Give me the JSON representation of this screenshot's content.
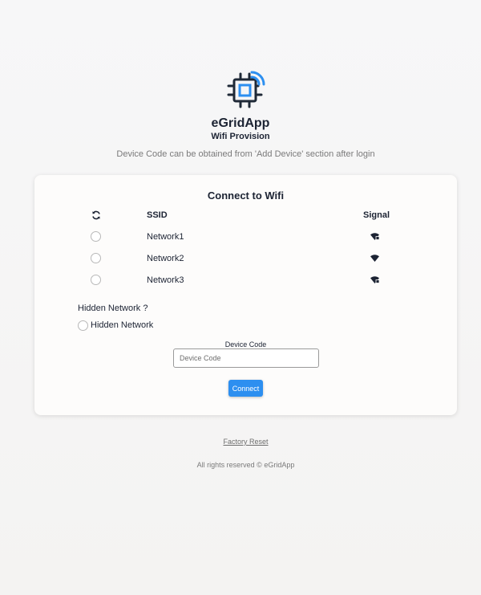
{
  "header": {
    "logo_icon": "chip-wifi-icon",
    "app_name": "eGridApp",
    "subtitle": "Wifi Provision",
    "hint": "Device Code can be obtained from 'Add Device' section after login"
  },
  "card": {
    "title": "Connect to Wifi",
    "refresh_icon": "refresh-icon",
    "columns": {
      "ssid": "SSID",
      "signal": "Signal"
    },
    "networks": [
      {
        "ssid": "Network1",
        "signal_icon": "wifi-lock-icon",
        "selected": false
      },
      {
        "ssid": "Network2",
        "signal_icon": "wifi-icon",
        "selected": false
      },
      {
        "ssid": "Network3",
        "signal_icon": "wifi-lock-icon",
        "selected": false
      }
    ],
    "hidden_question": "Hidden Network ?",
    "hidden_option": "Hidden Network",
    "device_code_label": "Device Code",
    "device_code_placeholder": "Device Code",
    "device_code_value": "",
    "connect_label": "Connect"
  },
  "links": {
    "factory_reset": "Factory Reset"
  },
  "footer": {
    "copyright": "All rights reserved © eGridApp"
  },
  "colors": {
    "accent": "#2d8ff0",
    "text": "#1c2333",
    "muted": "#7a7a7a",
    "logo": "#1f2937"
  }
}
